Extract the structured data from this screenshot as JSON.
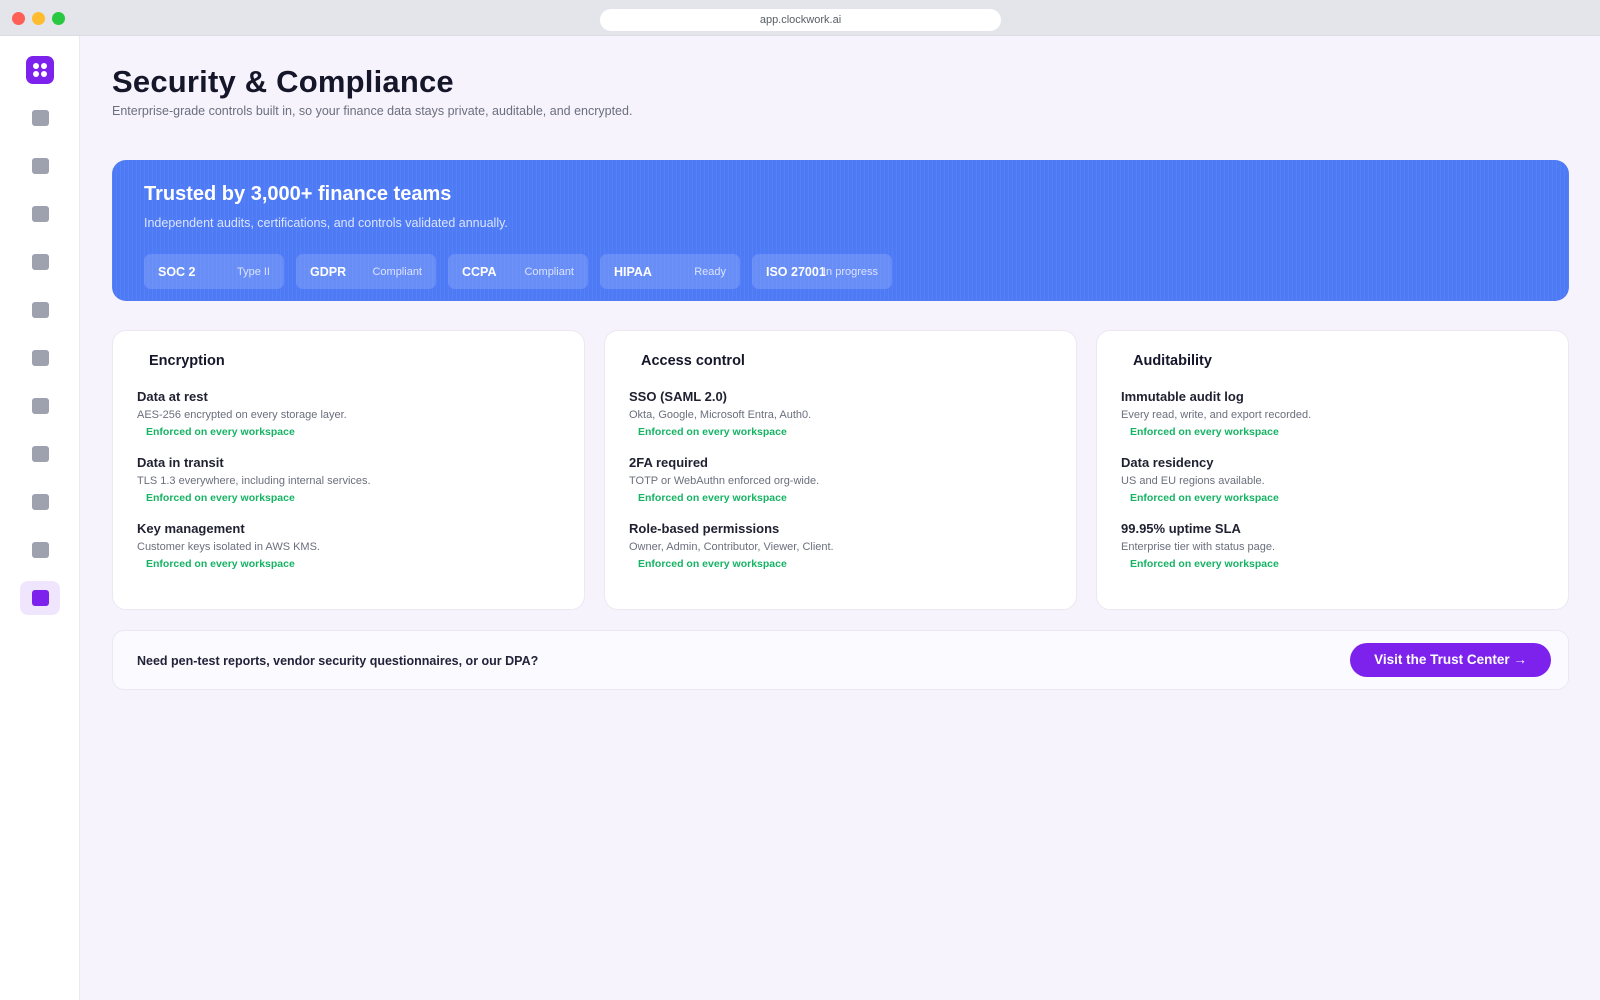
{
  "browser": {
    "url": "app.clockwork.ai"
  },
  "sidebar": {
    "logo_icon": "clockwork-logo-icon",
    "items": [
      {
        "icon": "nav-icon",
        "active": false
      },
      {
        "icon": "nav-icon",
        "active": false
      },
      {
        "icon": "nav-icon",
        "active": false
      },
      {
        "icon": "nav-icon",
        "active": false
      },
      {
        "icon": "nav-icon",
        "active": false
      },
      {
        "icon": "nav-icon",
        "active": false
      },
      {
        "icon": "nav-icon",
        "active": false
      },
      {
        "icon": "nav-icon",
        "active": false
      },
      {
        "icon": "nav-icon",
        "active": false
      },
      {
        "icon": "nav-icon",
        "active": false
      },
      {
        "icon": "nav-icon",
        "active": true
      }
    ]
  },
  "page": {
    "title": "Security & Compliance",
    "subtitle": "Enterprise-grade controls built in, so your finance data stays private, auditable, and encrypted."
  },
  "hero": {
    "title": "Trusted by 3,000+ finance teams",
    "subtitle": "Independent audits, certifications, and controls validated annually.",
    "badges": [
      {
        "name": "SOC 2",
        "status": "Type II"
      },
      {
        "name": "GDPR",
        "status": "Compliant"
      },
      {
        "name": "CCPA",
        "status": "Compliant"
      },
      {
        "name": "HIPAA",
        "status": "Ready"
      },
      {
        "name": "ISO 27001",
        "status": "In progress"
      }
    ]
  },
  "cards": [
    {
      "title": "Encryption",
      "items": [
        {
          "title": "Data at rest",
          "desc": "AES-256 encrypted on every storage layer.",
          "status": "Enforced on every workspace"
        },
        {
          "title": "Data in transit",
          "desc": "TLS 1.3 everywhere, including internal services.",
          "status": "Enforced on every workspace"
        },
        {
          "title": "Key management",
          "desc": "Customer keys isolated in AWS KMS.",
          "status": "Enforced on every workspace"
        }
      ]
    },
    {
      "title": "Access control",
      "items": [
        {
          "title": "SSO (SAML 2.0)",
          "desc": "Okta, Google, Microsoft Entra, Auth0.",
          "status": "Enforced on every workspace"
        },
        {
          "title": "2FA required",
          "desc": "TOTP or WebAuthn enforced org-wide.",
          "status": "Enforced on every workspace"
        },
        {
          "title": "Role-based permissions",
          "desc": "Owner, Admin, Contributor, Viewer, Client.",
          "status": "Enforced on every workspace"
        }
      ]
    },
    {
      "title": "Auditability",
      "items": [
        {
          "title": "Immutable audit log",
          "desc": "Every read, write, and export recorded.",
          "status": "Enforced on every workspace"
        },
        {
          "title": "Data residency",
          "desc": "US and EU regions available.",
          "status": "Enforced on every workspace"
        },
        {
          "title": "99.95% uptime SLA",
          "desc": "Enterprise tier with status page.",
          "status": "Enforced on every workspace"
        }
      ]
    }
  ],
  "cta": {
    "text": "Need pen-test reports, vendor security questionnaires, or our DPA?",
    "button_label": "Visit the Trust Center →"
  },
  "colors": {
    "accent": "#7c22ec",
    "hero_bg": "#4e7af6",
    "status_green": "#16b364",
    "page_bg": "#f6f3fc"
  }
}
